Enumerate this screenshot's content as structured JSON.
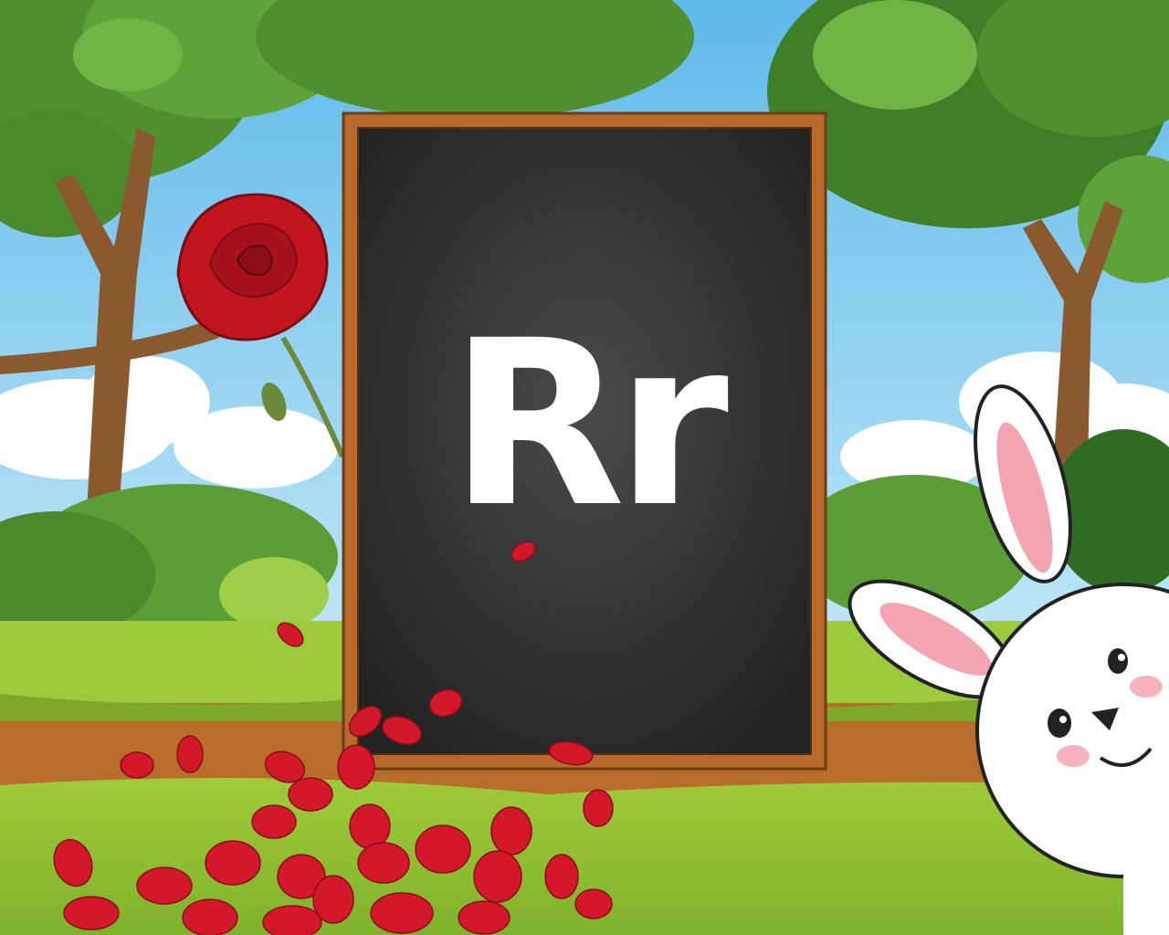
{
  "board": {
    "letter": "Rr"
  },
  "colors": {
    "sky": "#7cc7ee",
    "grass": "#8dbd35",
    "board_fill": "#2b2b2b",
    "frame": "#b86a2c",
    "rose": "#c2151f",
    "bunny_ear_inner": "#f4a3b0"
  },
  "icons": [
    "tree-icon",
    "rose-icon",
    "petal-icon",
    "bunny-icon",
    "bush-icon",
    "cloud-icon"
  ]
}
